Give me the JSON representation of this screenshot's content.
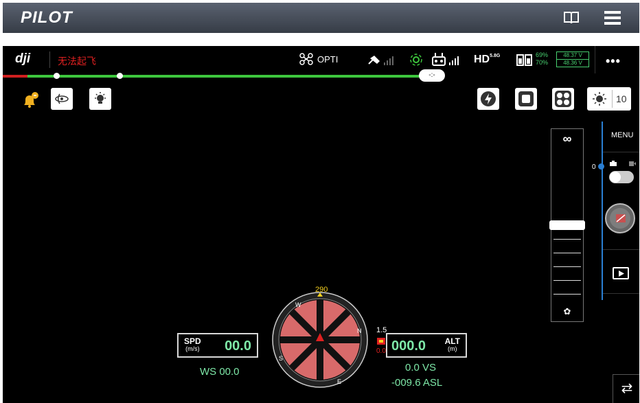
{
  "app": {
    "title": "PILOT"
  },
  "flight": {
    "brand": "dji",
    "warning": "无法起飞",
    "mode": "OPTI",
    "hd_label": "HD",
    "hd_band": "5.8G",
    "battery_pct_1": "69%",
    "battery_pct_2": "70%",
    "voltage_1": "48.37 V",
    "voltage_2": "48.36 V",
    "more": "•••",
    "bubble": "-:-"
  },
  "camera": {
    "iso_value": "10",
    "menu_label": "MENU",
    "slider_zero": "0",
    "focus_inf": "∞"
  },
  "telemetry": {
    "spd_label": "SPD",
    "spd_unit": "(m/s)",
    "spd_value": "00.0",
    "ws": "WS 00.0",
    "alt_label": "ALT",
    "alt_unit": "(m)",
    "alt_value": "000.0",
    "vs": "0.0  VS",
    "asl": "-009.6 ASL",
    "heading": "290",
    "obstacle_top": "1.5",
    "obstacle_bottom": "0.0"
  },
  "colors": {
    "accent_green": "#7ee8a8",
    "warning_red": "#e02020",
    "progress_green": "#3dc63d"
  }
}
